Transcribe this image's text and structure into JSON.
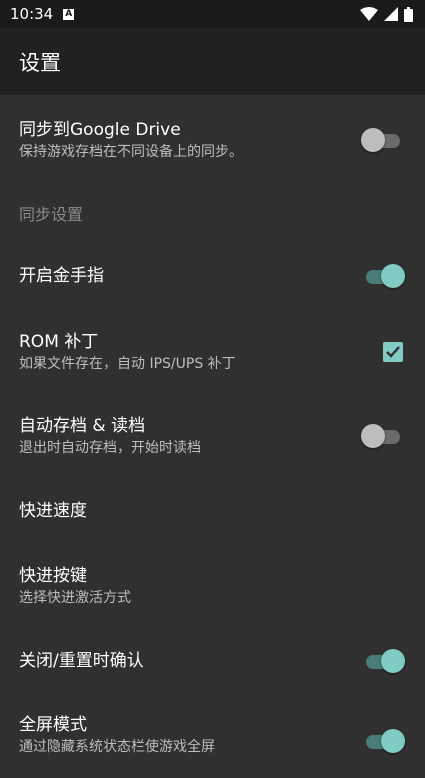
{
  "status_bar": {
    "time": "10:34",
    "notif": "A"
  },
  "toolbar": {
    "title": "设置"
  },
  "prefs": {
    "sync_drive": {
      "title": "同步到Google Drive",
      "summary": "保持游戏存档在不同设备上的同步。",
      "enabled": false
    },
    "sync_category": {
      "title": "同步设置"
    },
    "cheats": {
      "title": "开启金手指",
      "enabled": true
    },
    "rom_patch": {
      "title": "ROM 补丁",
      "summary": "如果文件存在，自动 IPS/UPS 补丁",
      "checked": true
    },
    "auto_save": {
      "title": "自动存档 & 读档",
      "summary": "退出时自动存档，开始时读档",
      "enabled": false
    },
    "ff_speed": {
      "title": "快进速度"
    },
    "ff_key": {
      "title": "快进按键",
      "summary": "选择快进激活方式"
    },
    "confirm_close": {
      "title": "关闭/重置时确认",
      "enabled": true
    },
    "fullscreen": {
      "title": "全屏模式",
      "summary": "通过隐藏系统状态栏使游戏全屏",
      "enabled": true
    }
  },
  "colors": {
    "accent": "#80cbc4",
    "background": "#303030",
    "toolbar": "#212121",
    "statusbar": "#1a1a1a"
  }
}
